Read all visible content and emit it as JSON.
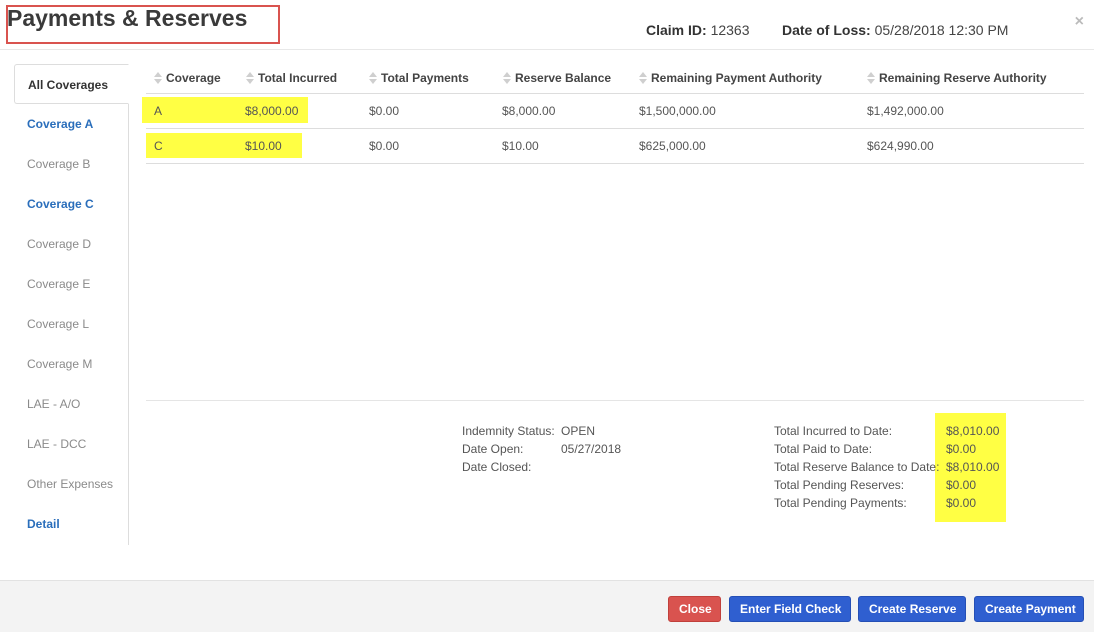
{
  "header": {
    "title": "Payments & Reserves",
    "claim_label": "Claim ID:",
    "claim_value": "12363",
    "loss_label": "Date of Loss:",
    "loss_value": "05/28/2018 12:30 PM",
    "close_glyph": "×"
  },
  "sidebar": {
    "items": [
      {
        "label": "All Coverages"
      },
      {
        "label": "Coverage A"
      },
      {
        "label": "Coverage B"
      },
      {
        "label": "Coverage C"
      },
      {
        "label": "Coverage D"
      },
      {
        "label": "Coverage E"
      },
      {
        "label": "Coverage L"
      },
      {
        "label": "Coverage M"
      },
      {
        "label": "LAE - A/O"
      },
      {
        "label": "LAE - DCC"
      },
      {
        "label": "Other Expenses"
      },
      {
        "label": "Detail"
      }
    ]
  },
  "table": {
    "headers": [
      "Coverage",
      "Total Incurred",
      "Total Payments",
      "Reserve Balance",
      "Remaining Payment Authority",
      "Remaining Reserve Authority"
    ],
    "rows": [
      [
        "A",
        "$8,000.00",
        "$0.00",
        "$8,000.00",
        "$1,500,000.00",
        "$1,492,000.00"
      ],
      [
        "C",
        "$10.00",
        "$0.00",
        "$10.00",
        "$625,000.00",
        "$624,990.00"
      ]
    ]
  },
  "summary": {
    "indemnity_status_label": "Indemnity Status:",
    "indemnity_status_value": "OPEN",
    "date_open_label": "Date Open:",
    "date_open_value": "05/27/2018",
    "date_closed_label": "Date Closed:",
    "date_closed_value": "",
    "totals": [
      {
        "label": "Total Incurred to Date:",
        "value": "$8,010.00"
      },
      {
        "label": "Total Paid to Date:",
        "value": "$0.00"
      },
      {
        "label": "Total Reserve Balance to Date:",
        "value": "$8,010.00"
      },
      {
        "label": "Total Pending Reserves:",
        "value": "$0.00"
      },
      {
        "label": "Total Pending Payments:",
        "value": "$0.00"
      }
    ]
  },
  "footer": {
    "close_label": "Close",
    "field_check_label": "Enter Field Check",
    "create_reserve_label": "Create Reserve",
    "create_payment_label": "Create Payment"
  },
  "colors": {
    "highlight": "#ffff44",
    "title_border": "#d9534f",
    "link": "#2a6ebb",
    "primary_button": "#2f5fd0",
    "danger_button": "#d9534f"
  }
}
